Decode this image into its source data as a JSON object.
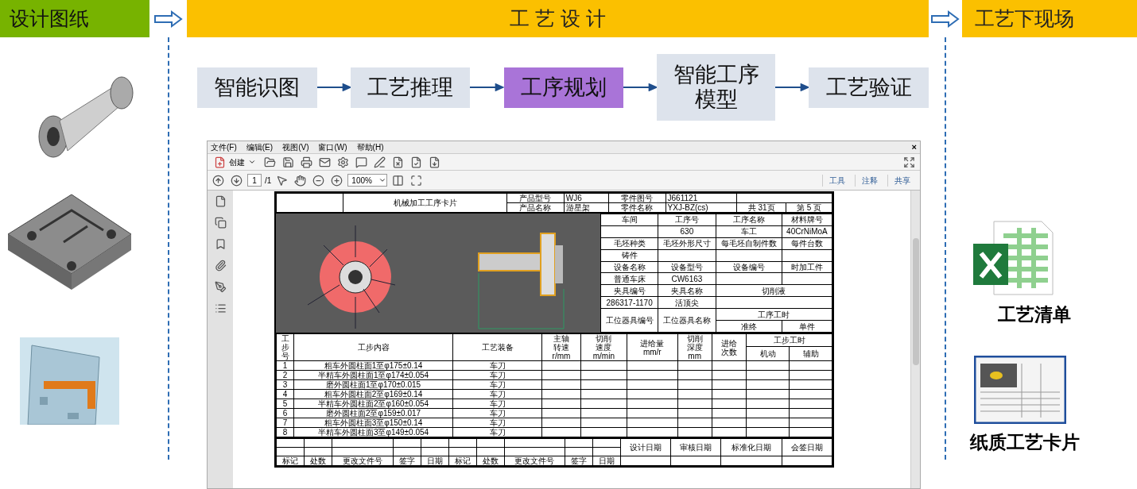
{
  "stages": [
    {
      "label": "设计图纸",
      "color": "#77b300"
    },
    {
      "label": "工 艺 设 计",
      "color": "#fbc000"
    },
    {
      "label": "工艺下现场",
      "color": "#fbc000"
    }
  ],
  "flow_steps": [
    {
      "label": "智能识图",
      "selected": false
    },
    {
      "label": "工艺推理",
      "selected": false
    },
    {
      "label": "工序规划",
      "selected": true
    },
    {
      "label": "智能工序模型",
      "selected": false
    },
    {
      "label": "工艺验证",
      "selected": false
    }
  ],
  "viewer": {
    "menu": [
      "文件(F)",
      "编辑(E)",
      "视图(V)",
      "窗口(W)",
      "帮助(H)"
    ],
    "close": "×",
    "create": "创建",
    "page": "1",
    "page_total": "/1",
    "zoom": "100%",
    "panels": [
      "工具",
      "注释",
      "共享"
    ]
  },
  "card": {
    "title": "机械加工工序卡片",
    "header": [
      {
        "label": "产品型号",
        "value": "WJ6"
      },
      {
        "label": "零件图号",
        "value": "J661121"
      },
      {
        "label": "产品名称",
        "value": "游星架"
      },
      {
        "label": "零件名称",
        "value": "YXJ-BZ(cs)"
      }
    ],
    "total_pages": "共 31页",
    "page_no": "第 5 页",
    "info_rows": [
      [
        "车间",
        "工序号",
        "工序名称",
        "材料牌号"
      ],
      [
        null,
        "630",
        "车工",
        "40CrNiMoA"
      ],
      [
        "毛坯种类",
        "毛坯外形尺寸",
        "每毛坯自制件数",
        "每件台数"
      ],
      [
        "铸件",
        null,
        null,
        null
      ],
      [
        "设备名称",
        "设备型号",
        "设备编号",
        "时加工件"
      ],
      [
        "普通车床",
        "CW6163",
        null,
        null
      ]
    ],
    "fixture_rows": [
      [
        "夹具编号",
        "夹具名称",
        "切削液"
      ],
      [
        "286317-1170",
        "活顶尖",
        null
      ]
    ],
    "station": {
      "labels": [
        "工位器具编号",
        "工位器具名称"
      ],
      "time_label": "工序工时",
      "time_cols": [
        "准终",
        "单件"
      ]
    },
    "steps": {
      "columns": [
        {
          "label": "工步号"
        },
        {
          "label": "工步内容"
        },
        {
          "label": "工艺装备"
        },
        {
          "label": "主轴转速",
          "unit": "r/mm"
        },
        {
          "label": "切削速度",
          "unit": "m/min"
        },
        {
          "label": "进给量",
          "unit": "mm/r"
        },
        {
          "label": "切削深度",
          "unit": "mm"
        },
        {
          "label": "进给次数"
        }
      ],
      "time_label": "工步工时",
      "time_cols": [
        "机动",
        "辅助"
      ],
      "rows": [
        {
          "no": "1",
          "content": "粗车外圆柱面1至φ175±0.14",
          "tool": "车刀"
        },
        {
          "no": "2",
          "content": "半精车外圆柱面1至φ174±0.054",
          "tool": "车刀"
        },
        {
          "no": "3",
          "content": "磨外圆柱面1至φ170±0.015",
          "tool": "车刀"
        },
        {
          "no": "4",
          "content": "粗车外圆柱面2至φ169±0.14",
          "tool": "车刀"
        },
        {
          "no": "5",
          "content": "半精车外圆柱面2至φ160±0.054",
          "tool": "车刀"
        },
        {
          "no": "6",
          "content": "磨外圆柱面2至φ159±0.017",
          "tool": "车刀"
        },
        {
          "no": "7",
          "content": "粗车外圆柱面3至φ150±0.14",
          "tool": "车刀"
        },
        {
          "no": "8",
          "content": "半精车外圆柱面3至φ149±0.054",
          "tool": "车刀"
        }
      ]
    },
    "footer": {
      "change_cols": [
        "标记",
        "处数",
        "更改文件号",
        "签字",
        "日期",
        "标记",
        "处数",
        "更改文件号",
        "签字",
        "日期"
      ],
      "sign_cols": [
        "设计日期",
        "审核日期",
        "标准化日期",
        "会签日期"
      ]
    }
  },
  "outputs": [
    {
      "kind": "spreadsheet",
      "label": "工艺清单"
    },
    {
      "kind": "card",
      "label": "纸质工艺卡片"
    }
  ]
}
